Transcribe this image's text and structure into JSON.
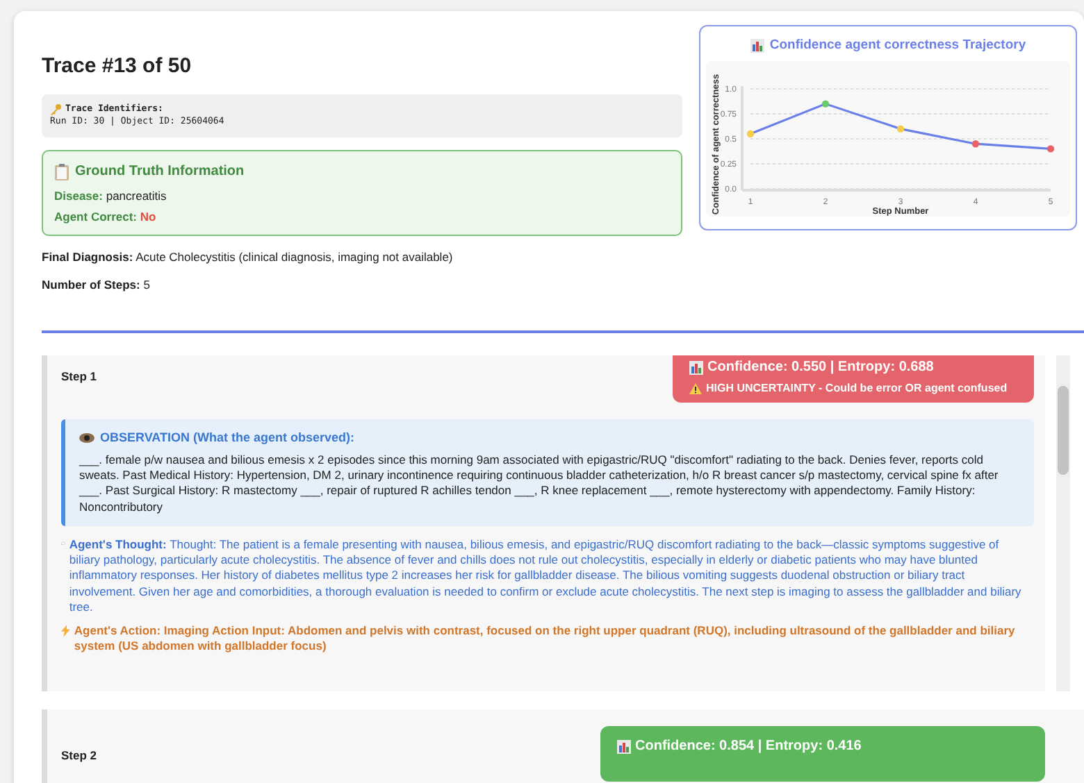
{
  "header": {
    "title": "Trace #13 of 50",
    "identifiers": {
      "heading": "Trace Identifiers:",
      "line": "Run ID: 30 | Object ID: 25604064"
    },
    "ground_truth": {
      "heading": "Ground Truth Information",
      "disease_label": "Disease:",
      "disease": "pancreatitis",
      "correct_label": "Agent Correct:",
      "correct_value": "No",
      "correct": false
    },
    "final_diagnosis_label": "Final Diagnosis:",
    "final_diagnosis": "Acute Cholecystitis (clinical diagnosis, imaging not available)",
    "steps_label": "Number of Steps:",
    "steps_count": "5"
  },
  "chart": {
    "chart_data": {
      "type": "line",
      "title": "Confidence agent correctness Trajectory",
      "xlabel": "Step Number",
      "ylabel": "Confidence of agent correctness",
      "x": [
        1,
        2,
        3,
        4,
        5
      ],
      "series": [
        {
          "color": "#6b7fe8",
          "marker": "circle",
          "values": [
            0.55,
            0.85,
            0.6,
            0.45,
            0.4
          ]
        }
      ],
      "grid": true,
      "xlim": [
        1,
        5
      ],
      "ylim": [
        0,
        1
      ],
      "xticks": [
        1,
        2,
        3,
        4,
        5
      ],
      "yticks": [
        {
          "value": 0,
          "label": "0.0"
        },
        {
          "value": 0.25,
          "label": "0.25"
        },
        {
          "value": 0.5,
          "label": "0.5"
        },
        {
          "value": 0.75,
          "label": "0.75"
        },
        {
          "value": 1,
          "label": "1.0"
        }
      ]
    }
  },
  "steps": [
    {
      "title": "Step 1",
      "kind": "uncertain",
      "confidence": "Confidence: 0.550 | Entropy: 0.688",
      "warning": "HIGH UNCERTAINTY - Could be error OR agent confused",
      "observation_heading": "OBSERVATION (What the agent observed):",
      "observation": "___. female p/w nausea and bilious emesis x 2 episodes since this morning 9am associated with epigastric/RUQ \"discomfort\" radiating to the back. Denies fever, reports cold sweats. Past Medical History: Hypertension, DM 2, urinary incontinence requiring continuous bladder catheterization, h/o R breast cancer s/p mastectomy, cervical spine fx after ___. Past Surgical History: R mastectomy ___, repair of ruptured R achilles tendon ___, R knee replacement ___, remote hysterectomy with appendectomy. Family History: Noncontributory",
      "thought_label": "Agent's Thought:",
      "thought": "Thought: The patient is a female presenting with nausea, bilious emesis, and epigastric/RUQ discomfort radiating to the back—classic symptoms suggestive of biliary pathology, particularly acute cholecystitis. The absence of fever and chills does not rule out cholecystitis, especially in elderly or diabetic patients who may have blunted inflammatory responses. Her history of diabetes mellitus type 2 increases her risk for gallbladder disease. The bilious vomiting suggests duodenal obstruction or biliary tract involvement. Given her age and comorbidities, a thorough evaluation is needed to confirm or exclude acute cholecystitis. The next step is imaging to assess the gallbladder and biliary tree.",
      "action": "Agent's Action: Imaging Action Input: Abdomen and pelvis with contrast, focused on the right upper quadrant (RUQ), including ultrasound of the gallbladder and biliary system (US abdomen with gallbladder focus)"
    },
    {
      "title": "Step 2",
      "kind": "confident",
      "confidence": "Confidence: 0.854 | Entropy: 0.416"
    }
  ]
}
